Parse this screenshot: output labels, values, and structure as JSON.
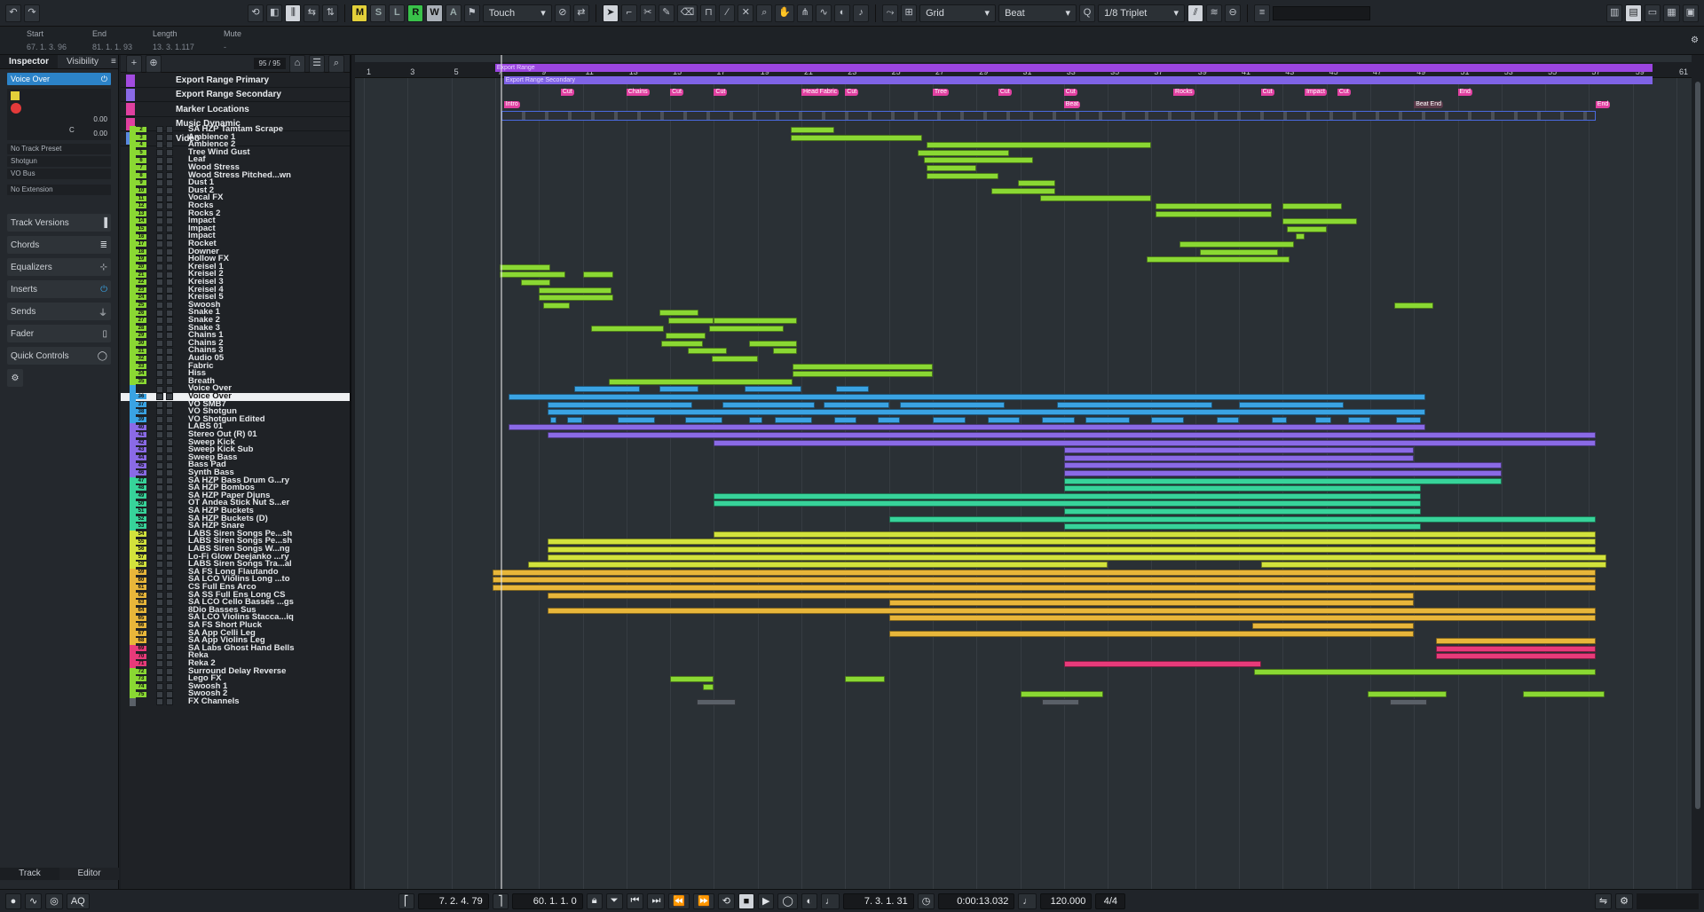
{
  "toolbar": {
    "buttons": {
      "m": "M",
      "s": "S",
      "l": "L",
      "r": "R",
      "w": "W",
      "a": "A"
    },
    "automation_mode": "Touch",
    "snap_type": "Grid",
    "grid_type": "Beat",
    "quantize": "1/8 Triplet"
  },
  "infoline": {
    "start_label": "Start",
    "start_value": "67. 1. 3. 96",
    "end_label": "End",
    "end_value": "81. 1. 1. 93",
    "length_label": "Length",
    "length_value": "13. 3. 1.117",
    "mute_label": "Mute",
    "mute_value": "-"
  },
  "inspector": {
    "tabs": [
      "Inspector",
      "Visibility"
    ],
    "track_name": "Voice Over",
    "volume": "0.00",
    "pan": "C",
    "pan_value": "0.00",
    "track_preset": "No Track Preset",
    "input": "Shotgun",
    "output": "VO Bus",
    "extension": "No Extension",
    "sections": [
      "Track Versions",
      "Chords",
      "Equalizers",
      "Inserts",
      "Sends",
      "Fader",
      "Quick Controls"
    ],
    "bottom_tabs": [
      "Track",
      "Editor"
    ]
  },
  "tracklist": {
    "count": "95 / 95",
    "ruler_tracks": [
      "Export Range Primary",
      "Export Range Secondary",
      "Marker Locations",
      "Music Dynamic",
      "Video"
    ],
    "tracks": [
      {
        "n": "2",
        "name": "SA HZP Tamtam Scrape",
        "c": "#8ad833"
      },
      {
        "n": "3",
        "name": "Ambience 1",
        "c": "#8ad833"
      },
      {
        "n": "4",
        "name": "Ambience 2",
        "c": "#8ad833"
      },
      {
        "n": "5",
        "name": "Tree Wind Gust",
        "c": "#8ad833"
      },
      {
        "n": "6",
        "name": "Leaf",
        "c": "#8ad833"
      },
      {
        "n": "7",
        "name": "Wood Stress",
        "c": "#8ad833"
      },
      {
        "n": "8",
        "name": "Wood Stress Pitched...wn",
        "c": "#8ad833"
      },
      {
        "n": "9",
        "name": "Dust 1",
        "c": "#8ad833"
      },
      {
        "n": "10",
        "name": "Dust 2",
        "c": "#8ad833"
      },
      {
        "n": "11",
        "name": "Vocal FX",
        "c": "#8ad833"
      },
      {
        "n": "12",
        "name": "Rocks",
        "c": "#8ad833"
      },
      {
        "n": "13",
        "name": "Rocks 2",
        "c": "#8ad833"
      },
      {
        "n": "14",
        "name": "Impact",
        "c": "#8ad833"
      },
      {
        "n": "15",
        "name": "Impact",
        "c": "#8ad833"
      },
      {
        "n": "16",
        "name": "Impact",
        "c": "#8ad833"
      },
      {
        "n": "17",
        "name": "Rocket",
        "c": "#8ad833"
      },
      {
        "n": "18",
        "name": "Downer",
        "c": "#8ad833"
      },
      {
        "n": "19",
        "name": "Hollow FX",
        "c": "#8ad833"
      },
      {
        "n": "20",
        "name": "Kreisel 1",
        "c": "#8ad833"
      },
      {
        "n": "21",
        "name": "Kreisel 2",
        "c": "#8ad833"
      },
      {
        "n": "22",
        "name": "Kreisel 3",
        "c": "#8ad833"
      },
      {
        "n": "23",
        "name": "Kreisel 4",
        "c": "#8ad833"
      },
      {
        "n": "24",
        "name": "Kreisel 5",
        "c": "#8ad833"
      },
      {
        "n": "25",
        "name": "Swoosh",
        "c": "#8ad833"
      },
      {
        "n": "26",
        "name": "Snake 1",
        "c": "#8ad833"
      },
      {
        "n": "27",
        "name": "Snake 2",
        "c": "#8ad833"
      },
      {
        "n": "28",
        "name": "Snake 3",
        "c": "#8ad833"
      },
      {
        "n": "29",
        "name": "Chains 1",
        "c": "#8ad833"
      },
      {
        "n": "30",
        "name": "Chains 2",
        "c": "#8ad833"
      },
      {
        "n": "31",
        "name": "Chains 3",
        "c": "#8ad833"
      },
      {
        "n": "32",
        "name": "Audio 05",
        "c": "#8ad833"
      },
      {
        "n": "33",
        "name": "Fabric",
        "c": "#8ad833"
      },
      {
        "n": "34",
        "name": "Hiss",
        "c": "#8ad833"
      },
      {
        "n": "35",
        "name": "Breath",
        "c": "#8ad833"
      },
      {
        "n": "",
        "name": "Voice Over",
        "c": "#3aa3e3"
      },
      {
        "n": "36",
        "name": "Voice Over",
        "c": "#3aa3e3"
      },
      {
        "n": "37",
        "name": "VO SMB7",
        "c": "#3aa3e3"
      },
      {
        "n": "38",
        "name": "VO Shotgun",
        "c": "#3aa3e3"
      },
      {
        "n": "39",
        "name": "VO Shotgun Edited",
        "c": "#3aa3e3"
      },
      {
        "n": "40",
        "name": "LABS 01",
        "c": "#8a6ae6"
      },
      {
        "n": "41",
        "name": "Stereo Out (R) 01",
        "c": "#8a6ae6"
      },
      {
        "n": "42",
        "name": "Sweep Kick",
        "c": "#8a6ae6"
      },
      {
        "n": "43",
        "name": "Sweep Kick Sub",
        "c": "#8a6ae6"
      },
      {
        "n": "44",
        "name": "Sweep Bass",
        "c": "#8a6ae6"
      },
      {
        "n": "45",
        "name": "Bass Pad",
        "c": "#8a6ae6"
      },
      {
        "n": "46",
        "name": "Synth Bass",
        "c": "#8a6ae6"
      },
      {
        "n": "47",
        "name": "SA HZP Bass Drum G...ry",
        "c": "#37d39a"
      },
      {
        "n": "48",
        "name": "SA HZP Bombos",
        "c": "#37d39a"
      },
      {
        "n": "49",
        "name": "SA HZP Paper Djuns",
        "c": "#37d39a"
      },
      {
        "n": "50",
        "name": "OT Andea Stick Nut S...er",
        "c": "#37d39a"
      },
      {
        "n": "51",
        "name": "SA HZP Buckets",
        "c": "#37d39a"
      },
      {
        "n": "52",
        "name": "SA HZP Buckets (D)",
        "c": "#37d39a"
      },
      {
        "n": "53",
        "name": "SA HZP Snare",
        "c": "#37d39a"
      },
      {
        "n": "54",
        "name": "LABS Siren Songs Pe...sh",
        "c": "#d2e23c"
      },
      {
        "n": "55",
        "name": "LABS Siren Songs Pe...sh",
        "c": "#d2e23c"
      },
      {
        "n": "56",
        "name": "LABS Siren Songs W...ng",
        "c": "#d2e23c"
      },
      {
        "n": "57",
        "name": "Lo-Fi Glow Deejanko ...ry",
        "c": "#d2e23c"
      },
      {
        "n": "58",
        "name": "LABS Siren Songs Tra...al",
        "c": "#d2e23c"
      },
      {
        "n": "59",
        "name": "SA FS Long Flautando",
        "c": "#e8b63a"
      },
      {
        "n": "60",
        "name": "SA LCO Violins Long ...to",
        "c": "#e8b63a"
      },
      {
        "n": "61",
        "name": "CS Full Ens Arco",
        "c": "#e8b63a"
      },
      {
        "n": "62",
        "name": "SA SS Full Ens Long CS",
        "c": "#e8b63a"
      },
      {
        "n": "63",
        "name": "SA LCO Cello Basses ...gs",
        "c": "#e8b63a"
      },
      {
        "n": "64",
        "name": "8Dio Basses Sus",
        "c": "#e8b63a"
      },
      {
        "n": "65",
        "name": "SA LCO Violins Stacca...iq",
        "c": "#e8b63a"
      },
      {
        "n": "66",
        "name": "SA FS Short Pluck",
        "c": "#e8b63a"
      },
      {
        "n": "67",
        "name": "SA App Celli Leg",
        "c": "#e8b63a"
      },
      {
        "n": "68",
        "name": "SA App Violins Leg",
        "c": "#e8b63a"
      },
      {
        "n": "69",
        "name": "SA Labs Ghost Hand Bells",
        "c": "#e83a7a"
      },
      {
        "n": "70",
        "name": "Reka",
        "c": "#e83a7a"
      },
      {
        "n": "71",
        "name": "Reka 2",
        "c": "#e83a7a"
      },
      {
        "n": "72",
        "name": "Surround Delay Reverse",
        "c": "#8ad833"
      },
      {
        "n": "73",
        "name": "Lego FX",
        "c": "#8ad833"
      },
      {
        "n": "74",
        "name": "Swoosh 1",
        "c": "#8ad833"
      },
      {
        "n": "75",
        "name": "Swoosh 2",
        "c": "#8ad833"
      },
      {
        "n": "",
        "name": "FX Channels",
        "c": "#5a6068"
      }
    ]
  },
  "ruler": {
    "bars": [
      "1",
      "3",
      "5",
      "7",
      "9",
      "11",
      "13",
      "15",
      "17",
      "19",
      "21",
      "23",
      "25",
      "27",
      "29",
      "31",
      "33",
      "35",
      "37",
      "39",
      "41",
      "43",
      "45",
      "47",
      "49",
      "51",
      "53",
      "55",
      "57",
      "59",
      "61"
    ],
    "export_primary": "Export Range",
    "export_secondary": "Export Range Secondary",
    "markers": [
      {
        "bar": 10,
        "label": "Cut"
      },
      {
        "bar": 13,
        "label": "Chains"
      },
      {
        "bar": 15,
        "label": "Cut"
      },
      {
        "bar": 17,
        "label": "Cut"
      },
      {
        "bar": 21,
        "label": "Head Fabric"
      },
      {
        "bar": 23,
        "label": "Cut"
      },
      {
        "bar": 27,
        "label": "Tree"
      },
      {
        "bar": 30,
        "label": "Cut"
      },
      {
        "bar": 33,
        "label": "Cut"
      },
      {
        "bar": 38,
        "label": "Rocks"
      },
      {
        "bar": 42,
        "label": "Cut"
      },
      {
        "bar": 44,
        "label": "Impact"
      },
      {
        "bar": 45.5,
        "label": "Cut"
      },
      {
        "bar": 51,
        "label": "End"
      }
    ],
    "dynamics": [
      {
        "bar": 7.4,
        "label": "Intro"
      },
      {
        "bar": 33,
        "label": "Beat"
      },
      {
        "bar": 49,
        "label": "Beat End"
      },
      {
        "bar": 57.3,
        "label": "End"
      }
    ]
  },
  "transport": {
    "left_locator": "7. 2. 4. 79",
    "right_locator": "60. 1. 1. 0",
    "position": "7. 3. 1. 31",
    "time": "0:00:13.032",
    "tempo": "120.000",
    "signature": "4/4",
    "aq": "AQ"
  }
}
